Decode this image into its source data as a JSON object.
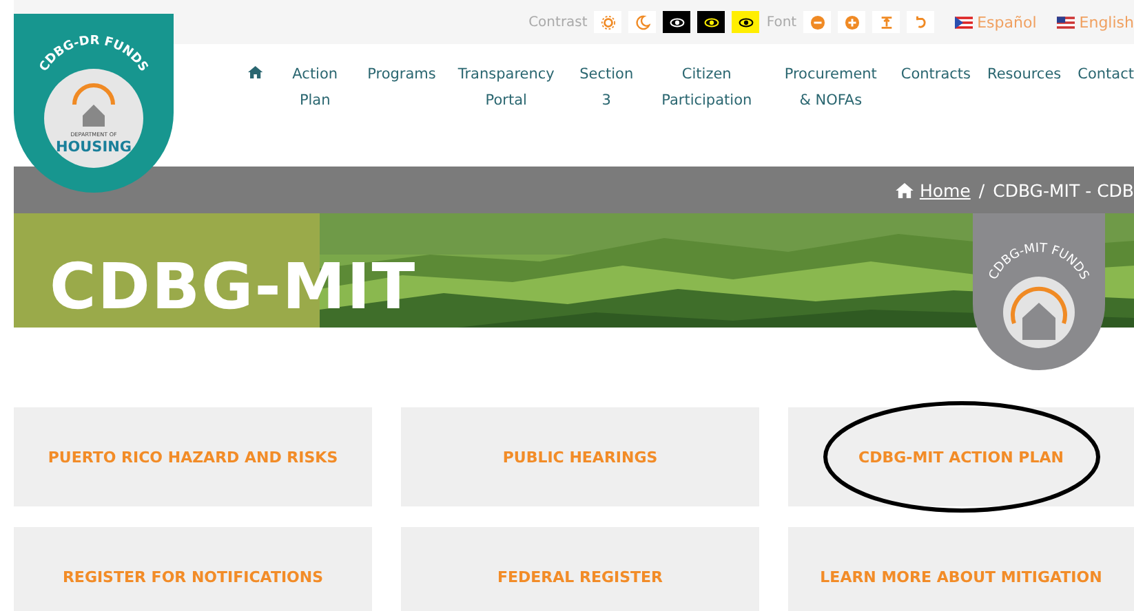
{
  "logo": {
    "arc_text": "CDBG-DR FUNDS",
    "department": "DEPARTMENT OF",
    "name": "HOUSING"
  },
  "toolbar": {
    "contrast_label": "Contrast",
    "contrast_buttons": [
      {
        "kind": "light"
      },
      {
        "kind": "dark"
      },
      {
        "kind": "black"
      },
      {
        "kind": "black-yellow"
      },
      {
        "kind": "yellow"
      }
    ],
    "font_label": "Font",
    "font_buttons": [
      {
        "kind": "minus"
      },
      {
        "kind": "plus"
      },
      {
        "kind": "spacing"
      },
      {
        "kind": "reset"
      }
    ],
    "languages": [
      {
        "label": "Español",
        "kind": "pr"
      },
      {
        "label": "English",
        "kind": "us"
      }
    ]
  },
  "nav": [
    "Action Plan",
    "Programs",
    "Transparency Portal",
    "Section 3",
    "Citizen Participation",
    "Procurement & NOFAs",
    "Contracts",
    "Resources",
    "Contact"
  ],
  "breadcrumb": {
    "home": "Home",
    "separator": "/",
    "current": "CDBG-MIT - CDB"
  },
  "hero": {
    "title": "CDBG-MIT",
    "badge_text": "CDBG-MIT FUNDS"
  },
  "cards": [
    {
      "label": "PUERTO RICO HAZARD AND RISKS",
      "circled": false
    },
    {
      "label": "PUBLIC HEARINGS",
      "circled": false
    },
    {
      "label": "CDBG-MIT ACTION PLAN",
      "circled": true
    },
    {
      "label": "REGISTER FOR NOTIFICATIONS",
      "circled": false
    },
    {
      "label": "FEDERAL REGISTER",
      "circled": false
    },
    {
      "label": "LEARN MORE ABOUT MITIGATION",
      "circled": false
    }
  ]
}
